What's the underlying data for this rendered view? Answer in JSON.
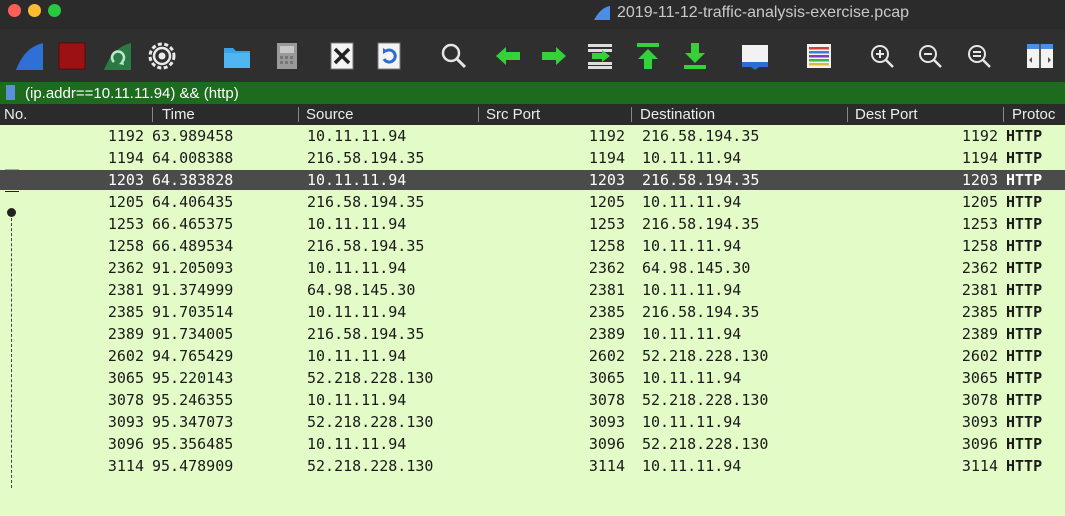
{
  "window": {
    "title": "2019-11-12-traffic-analysis-exercise.pcap",
    "traffic_lights": {
      "close": "#ff5f57",
      "minimize": "#febc2e",
      "zoom": "#28c840"
    }
  },
  "toolbar": {
    "icons": [
      "shark-fin-start-icon",
      "stop-square-icon",
      "shark-fin-restart-icon",
      "gear-options-icon",
      "folder-open-icon",
      "file-save-icon",
      "close-file-icon",
      "reload-icon",
      "find-magnifier-icon",
      "go-back-arrow-icon",
      "go-forward-arrow-icon",
      "go-to-packet-icon",
      "first-packet-icon",
      "last-packet-icon",
      "autoscroll-icon",
      "colorize-icon",
      "zoom-in-icon",
      "zoom-out-icon",
      "normal-size-icon",
      "resize-columns-icon"
    ]
  },
  "filter": {
    "value": "(ip.addr==10.11.11.94) && (http)"
  },
  "columns": [
    "No.",
    "Time",
    "Source",
    "Src Port",
    "Destination",
    "Dest Port",
    "Protoc"
  ],
  "colors": {
    "row_bg": "#e3fbc7",
    "selected_row_bg": "#4b4b4b",
    "filter_bg": "#1d6b1d",
    "header_bg": "#2b2b2b"
  },
  "packets": [
    {
      "no": "1192",
      "time": "63.989458",
      "source": "10.11.11.94",
      "src_port": "1192",
      "destination": "216.58.194.35",
      "dest_port": "1192",
      "protocol": "HTTP"
    },
    {
      "no": "1194",
      "time": "64.008388",
      "source": "216.58.194.35",
      "src_port": "1194",
      "destination": "10.11.11.94",
      "dest_port": "1194",
      "protocol": "HTTP"
    },
    {
      "no": "1203",
      "time": "64.383828",
      "source": "10.11.11.94",
      "src_port": "1203",
      "destination": "216.58.194.35",
      "dest_port": "1203",
      "protocol": "HTTP",
      "selected": true
    },
    {
      "no": "1205",
      "time": "64.406435",
      "source": "216.58.194.35",
      "src_port": "1205",
      "destination": "10.11.11.94",
      "dest_port": "1205",
      "protocol": "HTTP"
    },
    {
      "no": "1253",
      "time": "66.465375",
      "source": "10.11.11.94",
      "src_port": "1253",
      "destination": "216.58.194.35",
      "dest_port": "1253",
      "protocol": "HTTP"
    },
    {
      "no": "1258",
      "time": "66.489534",
      "source": "216.58.194.35",
      "src_port": "1258",
      "destination": "10.11.11.94",
      "dest_port": "1258",
      "protocol": "HTTP"
    },
    {
      "no": "2362",
      "time": "91.205093",
      "source": "10.11.11.94",
      "src_port": "2362",
      "destination": "64.98.145.30",
      "dest_port": "2362",
      "protocol": "HTTP"
    },
    {
      "no": "2381",
      "time": "91.374999",
      "source": "64.98.145.30",
      "src_port": "2381",
      "destination": "10.11.11.94",
      "dest_port": "2381",
      "protocol": "HTTP"
    },
    {
      "no": "2385",
      "time": "91.703514",
      "source": "10.11.11.94",
      "src_port": "2385",
      "destination": "216.58.194.35",
      "dest_port": "2385",
      "protocol": "HTTP"
    },
    {
      "no": "2389",
      "time": "91.734005",
      "source": "216.58.194.35",
      "src_port": "2389",
      "destination": "10.11.11.94",
      "dest_port": "2389",
      "protocol": "HTTP"
    },
    {
      "no": "2602",
      "time": "94.765429",
      "source": "10.11.11.94",
      "src_port": "2602",
      "destination": "52.218.228.130",
      "dest_port": "2602",
      "protocol": "HTTP"
    },
    {
      "no": "3065",
      "time": "95.220143",
      "source": "52.218.228.130",
      "src_port": "3065",
      "destination": "10.11.11.94",
      "dest_port": "3065",
      "protocol": "HTTP"
    },
    {
      "no": "3078",
      "time": "95.246355",
      "source": "10.11.11.94",
      "src_port": "3078",
      "destination": "52.218.228.130",
      "dest_port": "3078",
      "protocol": "HTTP"
    },
    {
      "no": "3093",
      "time": "95.347073",
      "source": "52.218.228.130",
      "src_port": "3093",
      "destination": "10.11.11.94",
      "dest_port": "3093",
      "protocol": "HTTP"
    },
    {
      "no": "3096",
      "time": "95.356485",
      "source": "10.11.11.94",
      "src_port": "3096",
      "destination": "52.218.228.130",
      "dest_port": "3096",
      "protocol": "HTTP"
    },
    {
      "no": "3114",
      "time": "95.478909",
      "source": "52.218.228.130",
      "src_port": "3114",
      "destination": "10.11.11.94",
      "dest_port": "3114",
      "protocol": "HTTP"
    }
  ]
}
